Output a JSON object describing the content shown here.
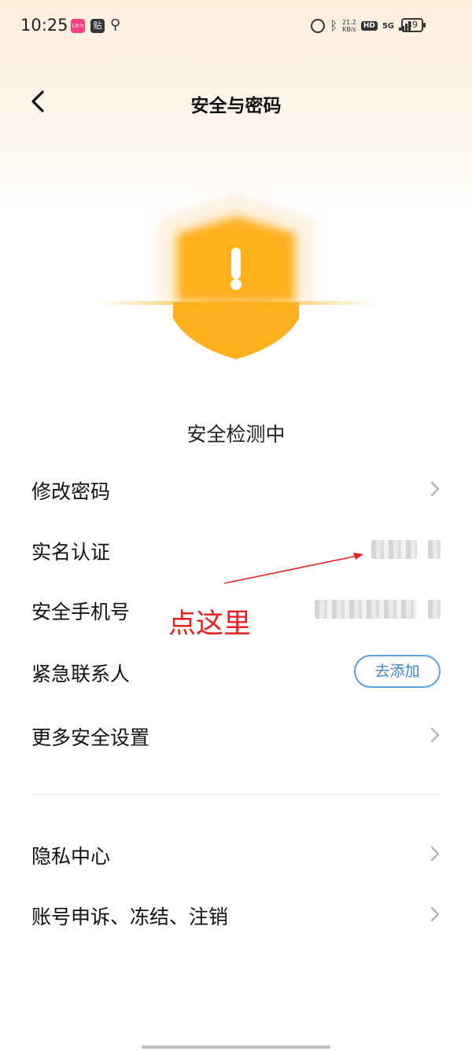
{
  "status_bar": {
    "time": "10:25",
    "app1": "Lit·h",
    "app2": "贴",
    "net_speed_value": "21.2",
    "net_speed_unit": "KB/s",
    "hd": "HD",
    "network": "5G",
    "battery": "39"
  },
  "header": {
    "title": "安全与密码"
  },
  "shield": {
    "scan_text": "安全检测中"
  },
  "detect_status": "安全检测中",
  "rows": [
    {
      "label": "修改密码"
    },
    {
      "label": "实名认证"
    },
    {
      "label": "安全手机号"
    },
    {
      "label": "紧急联系人",
      "button": "去添加"
    },
    {
      "label": "更多安全设置"
    },
    {
      "label": "隐私中心"
    },
    {
      "label": "账号申诉、冻结、注销"
    }
  ],
  "annotation": {
    "text": "点这里",
    "color": "#e8211e"
  },
  "colors": {
    "accent_blue": "#3b83cc",
    "shield_orange": "#ffb01f"
  }
}
